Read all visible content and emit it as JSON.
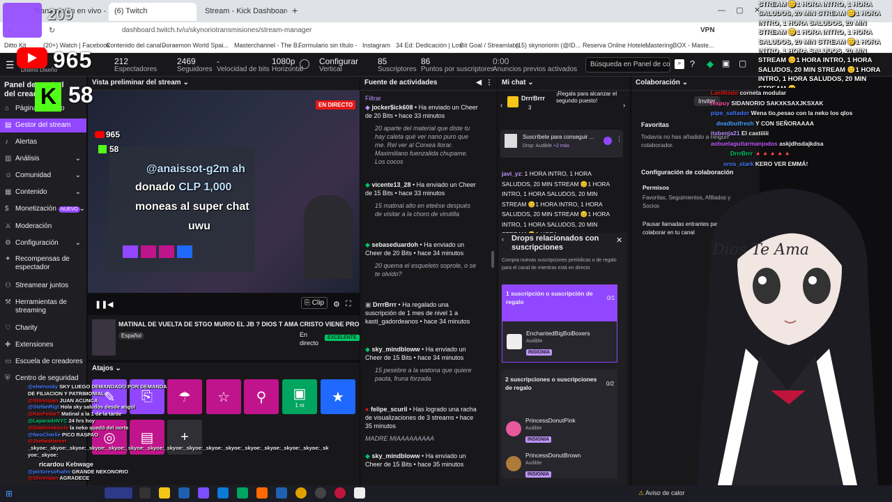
{
  "browser": {
    "tabs": [
      "Transmisión en vivo - YouTube",
      "(6) Twitch",
      "Stream - Kick Dashboard"
    ],
    "new_tab": "+",
    "url": "dashboard.twitch.tv/u/skynoriotransmisiones/stream-manager",
    "vpn": "VPN",
    "bookmarks": [
      "Ditto Kit",
      "(20+) Watch | Facebook",
      "Contenido del canal -",
      "Doraemon World Spai...",
      "Masterchannel - The B...",
      "Formulario sin título -",
      "Instagram",
      "34 Ed: Dedicación | Los",
      "Bit Goal / Streamlabs",
      "(15) skynoriorin (@ID...",
      "Reserva Online Hotele...",
      "MasteringBOX - Maste..."
    ]
  },
  "topbar": {
    "stats": [
      {
        "value": "212",
        "label": "Espectadores"
      },
      {
        "value": "2469",
        "label": "Seguidores"
      },
      {
        "value": "-",
        "label": "Velocidad de bits"
      },
      {
        "value": "1080p",
        "label": "Horizontal"
      },
      {
        "value": "Configurar",
        "label": "Vertical"
      },
      {
        "value": "85",
        "label": "Suscriptores"
      },
      {
        "value": "86",
        "label": "Puntos por suscriptores"
      },
      {
        "value": "0:00",
        "label": "Anuncios previos activados"
      }
    ],
    "search_placeholder": "Búsqueda en Panel de contro",
    "disenio_label": "Diseño Diseño"
  },
  "overlay_counters": {
    "yt": "965",
    "kick": "58",
    "mini_yt": "965",
    "mini_kick": "58",
    "top_extra": "209"
  },
  "sidebar": {
    "title": "Panel de control del creador",
    "items": [
      {
        "label": "Página de inicio",
        "icon": "home-icon"
      },
      {
        "label": "Gestor del stream",
        "icon": "stream-icon"
      },
      {
        "label": "Alertas",
        "icon": "bell-icon"
      },
      {
        "label": "Análisis",
        "icon": "chart-icon"
      },
      {
        "label": "Comunidad",
        "icon": "users-icon"
      },
      {
        "label": "Contenido",
        "icon": "content-icon"
      },
      {
        "label": "Monetización",
        "icon": "money-icon",
        "badge": "NUEVO"
      },
      {
        "label": "Moderación",
        "icon": "sword-icon"
      },
      {
        "label": "Configuración",
        "icon": "gear-icon"
      },
      {
        "label": "Recompensas de espectador",
        "icon": "reward-icon"
      },
      {
        "label": "Streamear juntos",
        "icon": "together-icon"
      },
      {
        "label": "Herramientas de streaming",
        "icon": "tools-icon"
      },
      {
        "label": "Charity",
        "icon": "heart-icon"
      },
      {
        "label": "Extensiones",
        "icon": "puzzle-icon"
      },
      {
        "label": "Escuela de creadores",
        "icon": "book-icon"
      },
      {
        "label": "Centro de seguridad",
        "icon": "shield-icon"
      }
    ]
  },
  "preview": {
    "header": "Vista preliminar del stream",
    "live": "EN DIRECTO",
    "donation_line1": "@anaissot-g2m ah",
    "donation_line2a": "donado ",
    "donation_amount": "CLP 1,000",
    "donation_line3": "moneas al super chat",
    "donation_line4": "uwu",
    "clip": "Clip"
  },
  "streaminfo": {
    "title": "MATINAL DE VUELTA DE STGO MURIO EL JB ? DIOS T AMA CRISTO VIENE PRONTO PARA D",
    "lang": "Español",
    "live": "En directo",
    "quality": "EXCELENTE"
  },
  "actions": {
    "header": "Atajos",
    "timer": "1 m",
    "add": "+"
  },
  "activity": {
    "header": "Fuente de actividades",
    "filter": "Filtrar",
    "items": [
      {
        "user": "jocker$ick608",
        "text": " • Ha enviado un Cheer de 20 Bits • hace 33 minutos",
        "msg": "20 aparte del material que diste tu hay caleta qué ver nano puro que me. Rel ver al Corxea llorar. Maximiliano fuenzalida chupame. Los cocos"
      },
      {
        "user": "vicente13_28",
        "text": " • Ha enviado un Cheer de 15 Bits • hace 33 minutos",
        "msg": "15 matinal alto en eteése después de visitar a la choro de virutilla"
      },
      {
        "user": "sebaseduardoh",
        "text": " • Ha enviado un Cheer de 20 Bits • hace 34 minutos",
        "msg": "20 quema el esqueleto soprole, o se te olvido?"
      },
      {
        "user": "DrrrBrrr",
        "text": " • Ha regalado una suscripción de 1 mes de nivel 1 a kasti_gadordeanos • hace 34 minutos",
        "msg": ""
      },
      {
        "user": "sky_mindbloww",
        "text": " • Ha enviado un Cheer de 15 Bits • hace 34 minutos",
        "msg": "15 pesebre a la watona que quiere pauta, fruna forzada"
      },
      {
        "user": "felipe_scuril",
        "text": " • Has logrado una racha de visualizaciones de 3 streams • hace 35 minutos",
        "msg": "MADRE MIAAAAAAAAA"
      },
      {
        "user": "sky_mindbloww",
        "text": " • Ha enviado un Cheer de 15 Bits • hace 35 minutos",
        "msg": ""
      }
    ]
  },
  "chat": {
    "header": "Mi chat",
    "gift_user": "DrrrBrrr",
    "gift_count": "3",
    "gift_text": "¡Regala para alcanzar el segundo puesto!",
    "promo_title": "Suscríbete para conseguir ...",
    "promo_sub": "Drop: Audible",
    "promo_more": "+2 más",
    "message_user": "javi_yz",
    "message": ": 1 HORA INTRO, 1 HORA SALUDOS, 20 MIN STREAM 😊1 HORA INTRO, 1 HORA SALUDOS, 20 MIN STREAM 😊1 HORA INTRO, 1 HORA SALUDOS, 20 MIN STREAM 😊1 HORA INTRO, 1 HORA SALUDOS, 20 MIN STREAM 😊1 HORA",
    "drops_title": "Drops relacionados con suscripciones",
    "drops_desc": "Compra nuevas suscripciones periódicas o de regalo para el canal de mientras está en directo",
    "drop1_title": "1 suscripción o suscripción de regalo",
    "drop1_count": "0/1",
    "drop1_item": "EnchantedBigBoiBoxers",
    "drop2_title": "2 suscripciones o suscripciones de regalo",
    "drop2_count": "0/2",
    "drop2_item1": "PrincessDonutPink",
    "drop2_item2": "PrincessDonutBrown",
    "brand": "Audible",
    "insignia": "INSIGNIA"
  },
  "collab": {
    "header": "Colaboración",
    "invite": "Invitar",
    "fav_title": "Favoritas",
    "fav_text": "Todavía no has añadido a ningún colaborador.",
    "config_title": "Configuración de colaboración",
    "perm_title": "Permisos",
    "perm_text": "Favoritas, Seguimientos, Afiliados y Socios",
    "pause_text": "Pausar llamadas entrantes para colaborar en tu canal"
  },
  "overlay_chat_right": {
    "scroll": "STREAM 😊1 HORA INTRO, 1 HORA SALUDOS, 20 MIN STREAM 😊1 HORA INTRO, 1 HORA SALUDOS, 20 MIN STREAM 😊1 HORA INTRO, 1 HORA SALUDOS, 20 MIN STREAM 😊1 HORA INTRO, 1 HORA SALUDOS, 20 MIN STREAM 😊1 HORA INTRO, 1 HORA SALUDOS, 20 MIN STREAM 😊1 HORA INTRO, 1 HORA SALUDOS, 20 MIN STREAM 😊",
    "lines": [
      {
        "user": "LastRodo",
        "text": "corneta modular"
      },
      {
        "user": "lexpuy",
        "text": "SIDANORIO SAKXKSAXJKSXAK"
      },
      {
        "user": "pipe_saltador",
        "text": "Wena tio,pesao con la neko los qlos"
      },
      {
        "user": "deadbutfresh",
        "text": "Y CON SEÑORAAAA"
      },
      {
        "user": "itsbenja21",
        "text": "El castiiiii"
      },
      {
        "user": "aobuelaguitarmanjodos",
        "text": "askjdhsdajkdsa"
      },
      {
        "user": "DrrrBrrr",
        "text": "🔺🔺🔺🔺🔺"
      },
      {
        "user": "oros_stark",
        "text": "KERO VER EMMÁ!"
      }
    ]
  },
  "overlay_chat_left": {
    "lines": [
      {
        "user": "@elwinosky",
        "text": "SKY LUEGO DEMANDADO POR DEMANDA DE FILIACION Y PATRIMONIAL"
      },
      {
        "user": "@Shinnipan",
        "text": "JUAN ACUNCA"
      },
      {
        "user": "@StefanRigt",
        "text": "Hola sky saludos desde angol"
      },
      {
        "user": "@KasFedarT",
        "text": "Matinal a la 1 de la tarde"
      },
      {
        "user": "@LaparadeNYC",
        "text": "24 hrs hoy"
      },
      {
        "user": "@Diablolokiscio",
        "text": "la neko quedó del norte"
      },
      {
        "user": "@NeoCharlie",
        "text": "PICO RASPAO"
      },
      {
        "user": "@Jsebastiannn",
        "text": "_skyoe:_skyoe:_skyoe:_skyoe:_skyoe:_skyoe:_skyoe:_skyoe:_skyoe:_skyoe:_skyoe:_skyoe:_skyoe:_skyoe:_skyoe:_sk yoe:_skyoe:"
      },
      {
        "user": "ricardou",
        "text": "Kebwage"
      },
      {
        "user": "@picturesofsaho",
        "text": "GRANDE NEKONORIO"
      },
      {
        "user": "@Shinnipan",
        "text": "AGRADECE"
      }
    ]
  },
  "vtuber": {
    "sign": "Dios Te Ama"
  },
  "taskbar": {
    "heat": "Aviso de calor"
  },
  "colors": {
    "purple": "#9147ff",
    "magenta": "#c0148c",
    "green": "#00c567",
    "blue": "#1f69ff"
  }
}
